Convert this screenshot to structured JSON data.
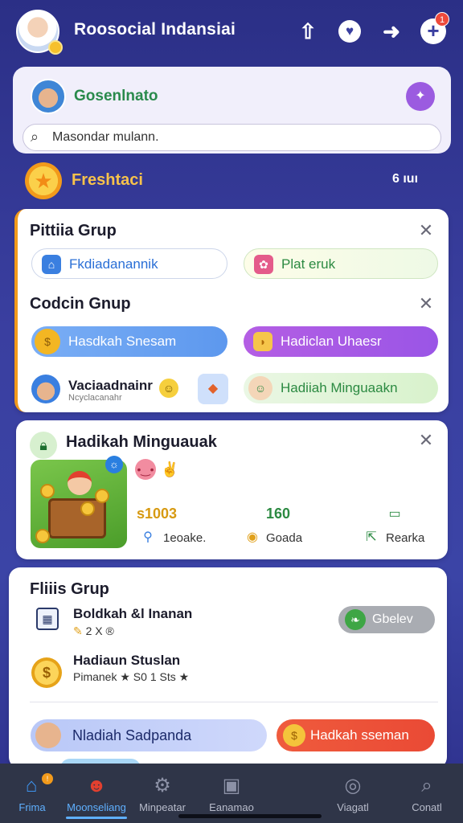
{
  "header": {
    "title": "Roosocial Indansiai",
    "notification_count": "1",
    "icons": [
      "upload-icon",
      "heart-icon",
      "arrow-right-icon",
      "plus-icon"
    ]
  },
  "profile": {
    "name": "Gosenlnato",
    "search_placeholder": "Masondar mulann."
  },
  "featured": {
    "label": "Freshtaci",
    "right_text": "6 ıuı"
  },
  "groups": {
    "title_primary": "Pittiia Grup",
    "pill_home": "Fkdiadanannik",
    "pill_green": "Plat eruk",
    "title_secondary": "Codcin Gnup",
    "pill_blue": "Hasdkah Snesam",
    "pill_purple": "Hadiclan Uhaesr",
    "member_name": "Vaciaadnainr",
    "member_sub": "Ncyclacanahr",
    "pill_weekly": "Hadiiah Minguaakn"
  },
  "weekly": {
    "title": "Hadikah Minguauak",
    "stats": [
      {
        "value": "s1003",
        "label": "1eoake.",
        "color": "#d79a12"
      },
      {
        "value": "160",
        "label": "Goada",
        "color": "#2c8a42"
      },
      {
        "value": "",
        "label": "Rearka",
        "color": "#2c8a42"
      }
    ]
  },
  "filter": {
    "title": "Fliiis Grup",
    "row1_title": "Boldkah &l Inanan",
    "row1_sub": "2 X ®",
    "row1_action": "Gbelev",
    "row2_title": "Hadiaun Stuslan",
    "row2_sub": "Pimanek ★ S0 1 Sts ★",
    "pill_left": "Nladiah Sadpanda",
    "pill_right": "Hadkah sseman"
  },
  "nav": {
    "items": [
      {
        "label": "Frima",
        "icon": "home-icon"
      },
      {
        "label": "Moonseliang",
        "icon": "mascot-icon"
      },
      {
        "label": "Minpeatar",
        "icon": "gear-icon"
      },
      {
        "label": "Eanamao",
        "icon": "camera-icon"
      },
      {
        "label": "Viagatl",
        "icon": "target-icon"
      },
      {
        "label": "Conatl",
        "icon": "search-icon"
      }
    ],
    "active_index": 1
  },
  "colors": {
    "background": "#2b2f86",
    "accent": "#5fb0ff",
    "orange": "#f29a1b"
  }
}
